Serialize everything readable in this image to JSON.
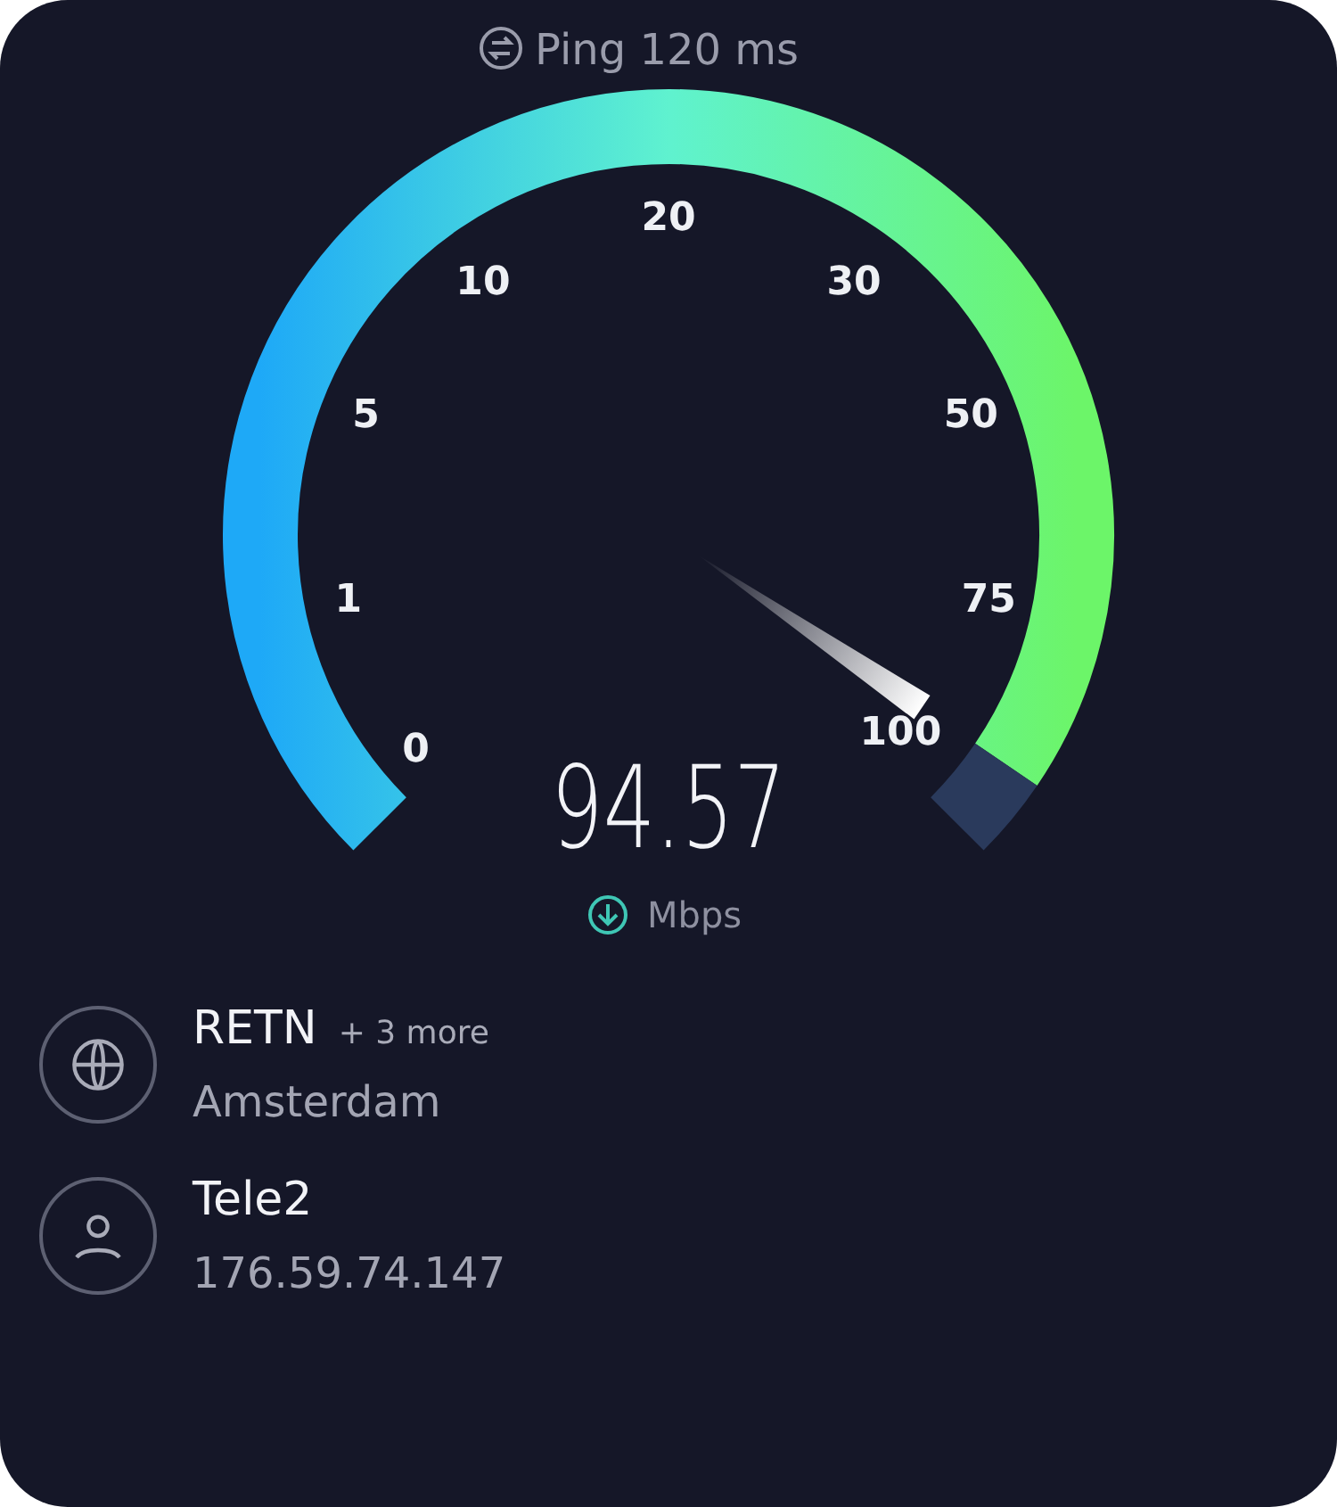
{
  "ping": {
    "label": "Ping",
    "value": "120 ms"
  },
  "gauge": {
    "ticks": [
      "0",
      "1",
      "5",
      "10",
      "20",
      "30",
      "50",
      "75",
      "100"
    ],
    "value": "94.57",
    "unit": "Mbps"
  },
  "servers": [
    {
      "kind": "host",
      "title": "RETN",
      "extra": "+ 3 more",
      "subtitle": "Amsterdam"
    },
    {
      "kind": "provider",
      "title": "Tele2",
      "subtitle": "176.59.74.147"
    }
  ]
}
